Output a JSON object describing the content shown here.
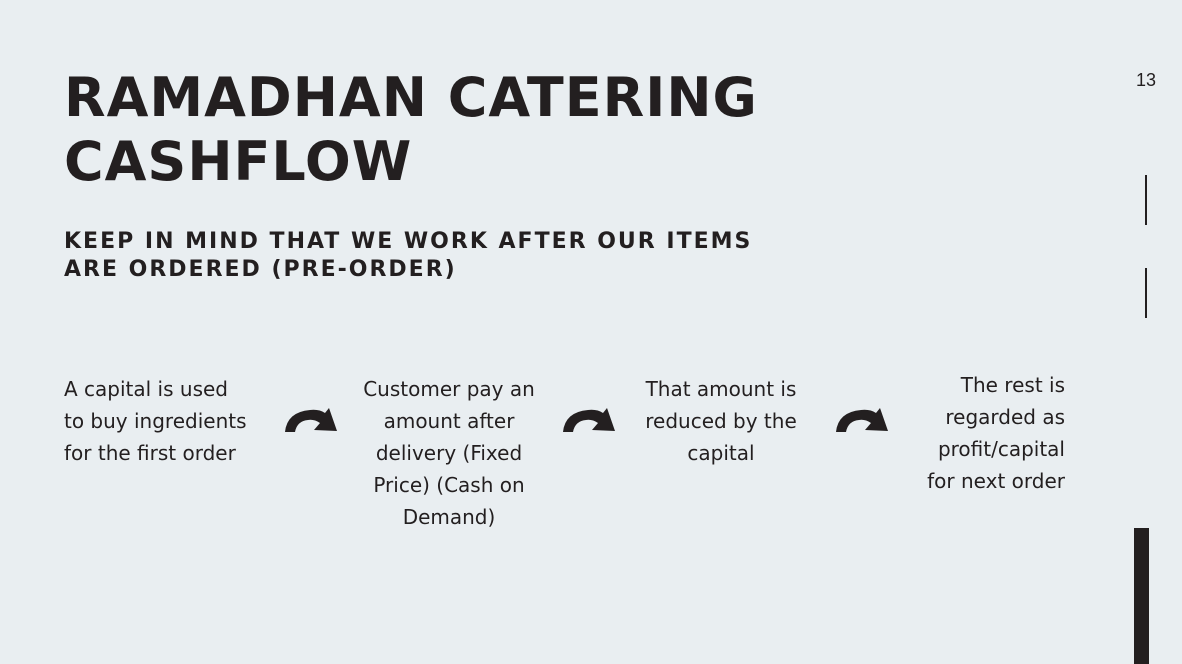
{
  "title": {
    "line1": "RAMADHAN CATERING",
    "line2": "CASHFLOW"
  },
  "subtitle": {
    "line1": "KEEP IN MIND THAT WE WORK AFTER OUR ITEMS",
    "line2": "ARE ORDERED (PRE-ORDER)"
  },
  "page_number": "13",
  "colors": {
    "background": "#e9eef1",
    "text": "#231f20"
  },
  "flow": {
    "steps": [
      {
        "lines": [
          "A capital is used",
          "to buy ingredients",
          "for the first order"
        ]
      },
      {
        "lines": [
          "Customer pay an",
          "amount after",
          "delivery (Fixed",
          "Price) (Cash on",
          "Demand)"
        ]
      },
      {
        "lines": [
          "That amount is",
          "reduced by the",
          "capital"
        ]
      },
      {
        "lines": [
          "The rest is",
          "regarded as",
          "profit/capital",
          "for next order"
        ]
      }
    ],
    "connector_icon": "curved-arrow-right-icon"
  }
}
